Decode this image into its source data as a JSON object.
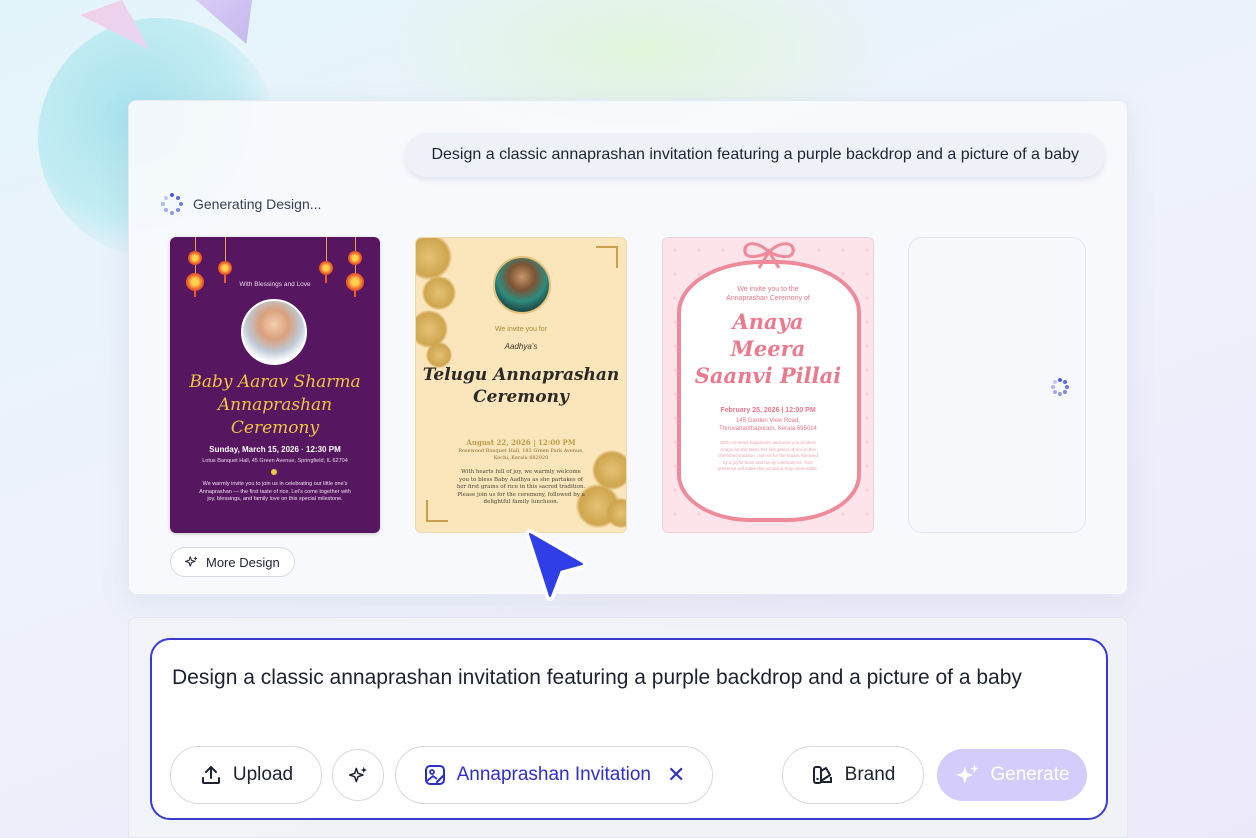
{
  "prompt_bubble": "Design a classic annaprashan invitation featuring a purple backdrop and a picture of a baby",
  "status_text": "Generating Design...",
  "cards": {
    "card1": {
      "tag": "With Blessings and Love",
      "name_line1": "Baby Aarav Sharma",
      "name_line2": "Annaprashan",
      "name_line3": "Ceremony",
      "date": "Sunday, March 15, 2026 · 12:30 PM",
      "venue": "Lotus Banquet Hall, 45 Green Avenue, Springfield, IL 62704",
      "message": "We warmly invite you to join us in celebrating our little one's Annaprashan — the first taste of rice. Let's come together with joy, blessings, and family love on this special milestone."
    },
    "card2": {
      "invite": "We invite you for",
      "child": "Aadhya's",
      "title_line1": "Telugu Annaprashan",
      "title_line2": "Ceremony",
      "date": "August 22, 2026 | 12:00 PM",
      "venue_line1": "Rosewood Banquet Hall, 183 Green Park Avenue,",
      "venue_line2": "Kochi, Kerala 682020",
      "body": "With hearts full of joy, we warmly welcome you to bless Baby Aadhya as she partakes of her first grains of rice in this sacred tradition. Please join us for the ceremony, followed by a delightful family luncheon."
    },
    "card3": {
      "invite_line1": "We invite you to the",
      "invite_line2": "Annaprashan Ceremony of",
      "name_line1": "Anaya",
      "name_line2": "Meera",
      "name_line3": "Saanvi Pillai",
      "date": "February 25, 2026 | 12:00 PM",
      "addr_line1": "145 Garden View Road,",
      "addr_line2": "Thiruvananthapuram, Kerala 695014",
      "body": "With immense happiness, welcome you to bless Anaya as she takes her first grains of rice in this cherished tradition. Join us for the rituals, followed by a joyful feast and family celebrations. Your presence will make this occasion truly memorable."
    }
  },
  "more_design_label": "More Design",
  "input": {
    "text": "Design a classic annaprashan invitation featuring a purple backdrop and a picture of a baby"
  },
  "buttons": {
    "upload": "Upload",
    "chip": "Annaprashan Invitation",
    "brand": "Brand",
    "generate": "Generate"
  },
  "icons": {
    "upload": "upload-icon",
    "magic": "sparkle-icon",
    "chip": "image-edit-icon",
    "chip_remove": "close-icon",
    "brand": "swatch-icon",
    "generate": "sparkle-icon",
    "spinner": "spinner-icon",
    "cursor": "pointer-cursor-icon"
  },
  "colors": {
    "accent": "#3a3ad0",
    "generate_disabled": "#d4cdfb",
    "card1_bg": "#571660",
    "card2_bg": "#fbe5bb",
    "card3_bg": "#fde4ea"
  }
}
